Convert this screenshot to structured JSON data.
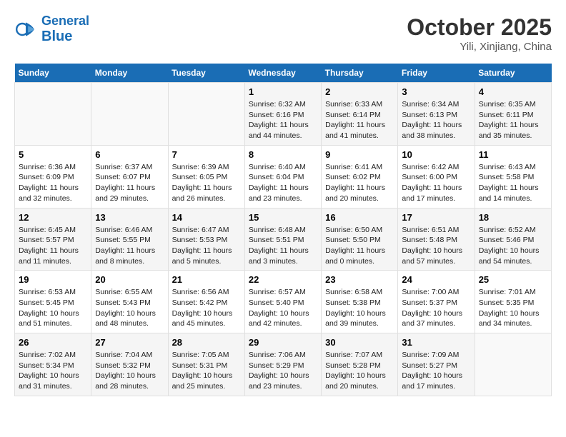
{
  "header": {
    "logo_line1": "General",
    "logo_line2": "Blue",
    "month": "October 2025",
    "location": "Yili, Xinjiang, China"
  },
  "weekdays": [
    "Sunday",
    "Monday",
    "Tuesday",
    "Wednesday",
    "Thursday",
    "Friday",
    "Saturday"
  ],
  "weeks": [
    [
      {
        "day": "",
        "sunrise": "",
        "sunset": "",
        "daylight": ""
      },
      {
        "day": "",
        "sunrise": "",
        "sunset": "",
        "daylight": ""
      },
      {
        "day": "",
        "sunrise": "",
        "sunset": "",
        "daylight": ""
      },
      {
        "day": "1",
        "sunrise": "Sunrise: 6:32 AM",
        "sunset": "Sunset: 6:16 PM",
        "daylight": "Daylight: 11 hours and 44 minutes."
      },
      {
        "day": "2",
        "sunrise": "Sunrise: 6:33 AM",
        "sunset": "Sunset: 6:14 PM",
        "daylight": "Daylight: 11 hours and 41 minutes."
      },
      {
        "day": "3",
        "sunrise": "Sunrise: 6:34 AM",
        "sunset": "Sunset: 6:13 PM",
        "daylight": "Daylight: 11 hours and 38 minutes."
      },
      {
        "day": "4",
        "sunrise": "Sunrise: 6:35 AM",
        "sunset": "Sunset: 6:11 PM",
        "daylight": "Daylight: 11 hours and 35 minutes."
      }
    ],
    [
      {
        "day": "5",
        "sunrise": "Sunrise: 6:36 AM",
        "sunset": "Sunset: 6:09 PM",
        "daylight": "Daylight: 11 hours and 32 minutes."
      },
      {
        "day": "6",
        "sunrise": "Sunrise: 6:37 AM",
        "sunset": "Sunset: 6:07 PM",
        "daylight": "Daylight: 11 hours and 29 minutes."
      },
      {
        "day": "7",
        "sunrise": "Sunrise: 6:39 AM",
        "sunset": "Sunset: 6:05 PM",
        "daylight": "Daylight: 11 hours and 26 minutes."
      },
      {
        "day": "8",
        "sunrise": "Sunrise: 6:40 AM",
        "sunset": "Sunset: 6:04 PM",
        "daylight": "Daylight: 11 hours and 23 minutes."
      },
      {
        "day": "9",
        "sunrise": "Sunrise: 6:41 AM",
        "sunset": "Sunset: 6:02 PM",
        "daylight": "Daylight: 11 hours and 20 minutes."
      },
      {
        "day": "10",
        "sunrise": "Sunrise: 6:42 AM",
        "sunset": "Sunset: 6:00 PM",
        "daylight": "Daylight: 11 hours and 17 minutes."
      },
      {
        "day": "11",
        "sunrise": "Sunrise: 6:43 AM",
        "sunset": "Sunset: 5:58 PM",
        "daylight": "Daylight: 11 hours and 14 minutes."
      }
    ],
    [
      {
        "day": "12",
        "sunrise": "Sunrise: 6:45 AM",
        "sunset": "Sunset: 5:57 PM",
        "daylight": "Daylight: 11 hours and 11 minutes."
      },
      {
        "day": "13",
        "sunrise": "Sunrise: 6:46 AM",
        "sunset": "Sunset: 5:55 PM",
        "daylight": "Daylight: 11 hours and 8 minutes."
      },
      {
        "day": "14",
        "sunrise": "Sunrise: 6:47 AM",
        "sunset": "Sunset: 5:53 PM",
        "daylight": "Daylight: 11 hours and 5 minutes."
      },
      {
        "day": "15",
        "sunrise": "Sunrise: 6:48 AM",
        "sunset": "Sunset: 5:51 PM",
        "daylight": "Daylight: 11 hours and 3 minutes."
      },
      {
        "day": "16",
        "sunrise": "Sunrise: 6:50 AM",
        "sunset": "Sunset: 5:50 PM",
        "daylight": "Daylight: 11 hours and 0 minutes."
      },
      {
        "day": "17",
        "sunrise": "Sunrise: 6:51 AM",
        "sunset": "Sunset: 5:48 PM",
        "daylight": "Daylight: 10 hours and 57 minutes."
      },
      {
        "day": "18",
        "sunrise": "Sunrise: 6:52 AM",
        "sunset": "Sunset: 5:46 PM",
        "daylight": "Daylight: 10 hours and 54 minutes."
      }
    ],
    [
      {
        "day": "19",
        "sunrise": "Sunrise: 6:53 AM",
        "sunset": "Sunset: 5:45 PM",
        "daylight": "Daylight: 10 hours and 51 minutes."
      },
      {
        "day": "20",
        "sunrise": "Sunrise: 6:55 AM",
        "sunset": "Sunset: 5:43 PM",
        "daylight": "Daylight: 10 hours and 48 minutes."
      },
      {
        "day": "21",
        "sunrise": "Sunrise: 6:56 AM",
        "sunset": "Sunset: 5:42 PM",
        "daylight": "Daylight: 10 hours and 45 minutes."
      },
      {
        "day": "22",
        "sunrise": "Sunrise: 6:57 AM",
        "sunset": "Sunset: 5:40 PM",
        "daylight": "Daylight: 10 hours and 42 minutes."
      },
      {
        "day": "23",
        "sunrise": "Sunrise: 6:58 AM",
        "sunset": "Sunset: 5:38 PM",
        "daylight": "Daylight: 10 hours and 39 minutes."
      },
      {
        "day": "24",
        "sunrise": "Sunrise: 7:00 AM",
        "sunset": "Sunset: 5:37 PM",
        "daylight": "Daylight: 10 hours and 37 minutes."
      },
      {
        "day": "25",
        "sunrise": "Sunrise: 7:01 AM",
        "sunset": "Sunset: 5:35 PM",
        "daylight": "Daylight: 10 hours and 34 minutes."
      }
    ],
    [
      {
        "day": "26",
        "sunrise": "Sunrise: 7:02 AM",
        "sunset": "Sunset: 5:34 PM",
        "daylight": "Daylight: 10 hours and 31 minutes."
      },
      {
        "day": "27",
        "sunrise": "Sunrise: 7:04 AM",
        "sunset": "Sunset: 5:32 PM",
        "daylight": "Daylight: 10 hours and 28 minutes."
      },
      {
        "day": "28",
        "sunrise": "Sunrise: 7:05 AM",
        "sunset": "Sunset: 5:31 PM",
        "daylight": "Daylight: 10 hours and 25 minutes."
      },
      {
        "day": "29",
        "sunrise": "Sunrise: 7:06 AM",
        "sunset": "Sunset: 5:29 PM",
        "daylight": "Daylight: 10 hours and 23 minutes."
      },
      {
        "day": "30",
        "sunrise": "Sunrise: 7:07 AM",
        "sunset": "Sunset: 5:28 PM",
        "daylight": "Daylight: 10 hours and 20 minutes."
      },
      {
        "day": "31",
        "sunrise": "Sunrise: 7:09 AM",
        "sunset": "Sunset: 5:27 PM",
        "daylight": "Daylight: 10 hours and 17 minutes."
      },
      {
        "day": "",
        "sunrise": "",
        "sunset": "",
        "daylight": ""
      }
    ]
  ]
}
